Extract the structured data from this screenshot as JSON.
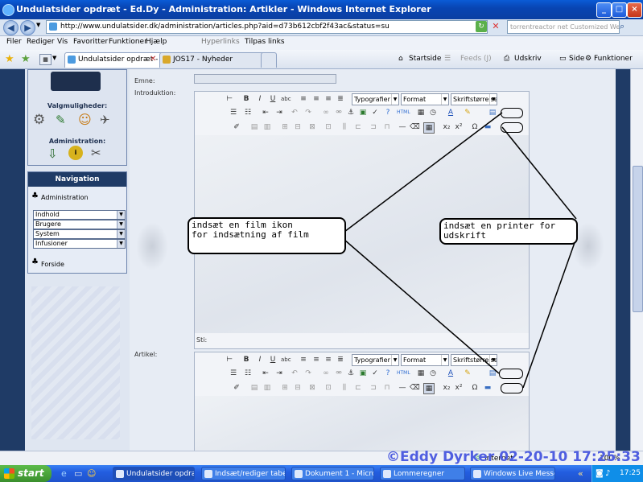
{
  "window": {
    "title": "Undulatsider opdræt - Ed.Dy - Administration: Artikler - Windows Internet Explorer"
  },
  "address": {
    "url": "http://www.undulatsider.dk/administration/articles.php?aid=d73b612cbf2f43ac&status=su",
    "search_placeholder": "torrentreactor net Customized Web Se..."
  },
  "menu": {
    "items": [
      "Filer",
      "Rediger",
      "Vis",
      "Favoritter",
      "Funktioner",
      "Hjælp"
    ],
    "links": [
      "Hyperlinks",
      "Tilpas links"
    ]
  },
  "tabs": [
    {
      "label": "Undulatsider opdræt - Ed..."
    },
    {
      "label": "JOS17 - Nyheder"
    }
  ],
  "commands": [
    "Startside",
    "Feeds (J)",
    "Udskriv",
    "Side",
    "Funktioner"
  ],
  "sidebar": {
    "valg_heading": "Valgmuligheder:",
    "admin_heading": "Administration:",
    "nav_heading": "Navigation",
    "admin_link": "Administration",
    "selects": [
      "Indhold",
      "Brugere",
      "System",
      "Infusioner"
    ],
    "forside_link": "Forside"
  },
  "form": {
    "emne_label": "Emne:",
    "intro_label": "Introduktion:",
    "article_label": "Artikel:",
    "path_label": "Sti:",
    "toolbar": {
      "typografier": "Typografier",
      "format": "Format",
      "skrift": "Skriftstørrelse"
    }
  },
  "callouts": {
    "film_line1": "indsæt en film ikon",
    "film_line2": "for indsætning af film",
    "printer_line1": "indsæt en printer for",
    "printer_line2": "udskrift"
  },
  "status": {
    "watermark": "©Eddy Dyrker 02-20-10 17:25:33",
    "internet": "Internet",
    "zoom": "100%"
  },
  "taskbar": {
    "start": "start",
    "tasks": [
      "Undulatsider opdræt ...",
      "Indsæt/rediger tabel ...",
      "Dokument 1 - Microso...",
      "Lommeregner",
      "Windows Live Messen..."
    ],
    "clock": "17:25"
  }
}
